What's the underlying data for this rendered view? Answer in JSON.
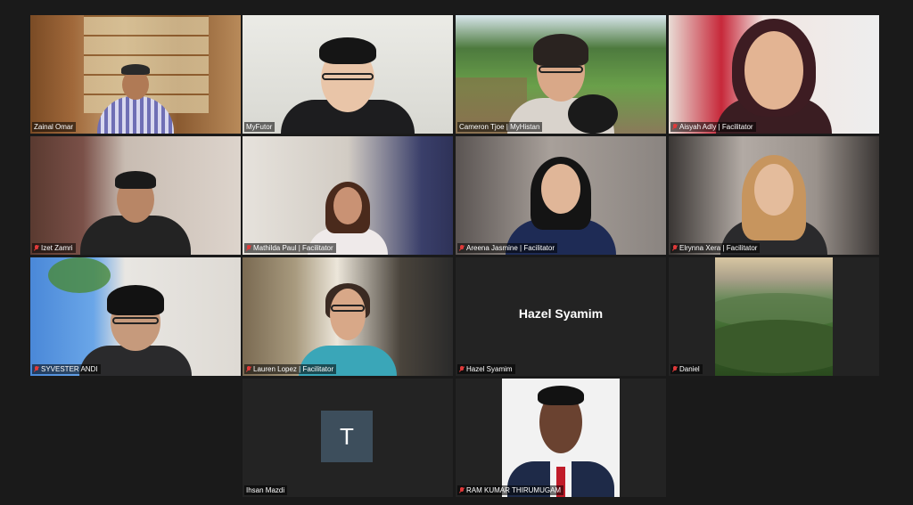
{
  "meeting": {
    "participants": [
      {
        "name": "Zainal Omar"
      },
      {
        "name": "MyFutor"
      },
      {
        "name": "Cameron Tjoe | MyHistan"
      },
      {
        "name": "Aisyah Adly | Facilitator"
      },
      {
        "name": "Izet Zamri"
      },
      {
        "name": "Mathilda Paul | Facilitator"
      },
      {
        "name": "Areena Jasmine | Facilitator"
      },
      {
        "name": "Elrynna Xera | Facilitator"
      },
      {
        "name": "SYVESTER ANDI"
      },
      {
        "name": "Lauren Lopez | Facilitator"
      },
      {
        "name": "Hazel Syamim",
        "display_name": "Hazel Syamim"
      },
      {
        "name": "Daniel"
      },
      {
        "name": "Ihsan Mazdi",
        "avatar_letter": "T"
      },
      {
        "name": "RAM KUMAR THIRUMUGAM"
      }
    ]
  },
  "colors": {
    "background": "#1a1a1a",
    "active_speaker_border": "#c9d44a",
    "muted_mic": "#e03a3a",
    "avatar_box": "#3d4e5c"
  },
  "icons": {
    "muted": "mic-off-icon"
  }
}
